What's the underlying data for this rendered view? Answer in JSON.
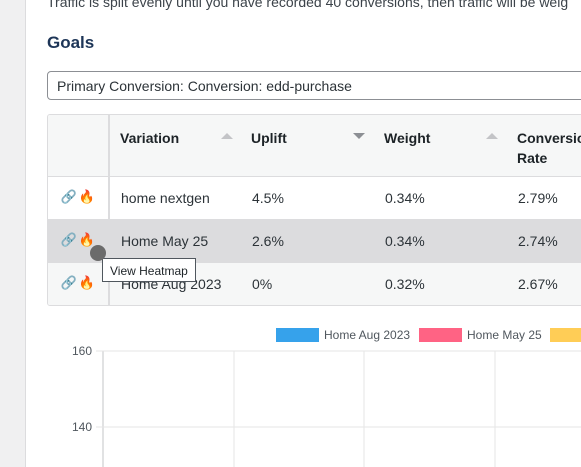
{
  "intro_text": "Traffic is split evenly until you have recorded 40 conversions, then traffic will be weig",
  "goals": {
    "title": "Goals",
    "selected": "Primary Conversion: Conversion: edd-purchase"
  },
  "table": {
    "headers": {
      "variation": "Variation",
      "uplift": "Uplift",
      "weight": "Weight",
      "conversion_line1": "Conversio",
      "conversion_line2": "Rate"
    },
    "rows": [
      {
        "variation": "home nextgen",
        "uplift": "4.5%",
        "weight": "0.34%",
        "conversion": "2.79%"
      },
      {
        "variation": "Home May 25",
        "uplift": "2.6%",
        "weight": "0.34%",
        "conversion": "2.74%"
      },
      {
        "variation": "Home Aug 2023",
        "uplift": "0%",
        "weight": "0.32%",
        "conversion": "2.67%"
      }
    ],
    "row_icons": [
      "link-icon",
      "fire-icon"
    ]
  },
  "tooltip": "View Heatmap",
  "chart_data": {
    "type": "line",
    "legend": [
      {
        "name": "Home Aug 2023",
        "color": "#36a2eb"
      },
      {
        "name": "Home May 25",
        "color": "#ff6384"
      },
      {
        "name": "",
        "color": "#ffcd56"
      }
    ],
    "yticks": [
      "160",
      "140"
    ],
    "ylim": [
      120,
      160
    ],
    "grid": true,
    "series": []
  },
  "colors": {
    "hover_row": "#dcdcde",
    "alt_row": "#f6f7f7",
    "title": "#1d3557"
  }
}
